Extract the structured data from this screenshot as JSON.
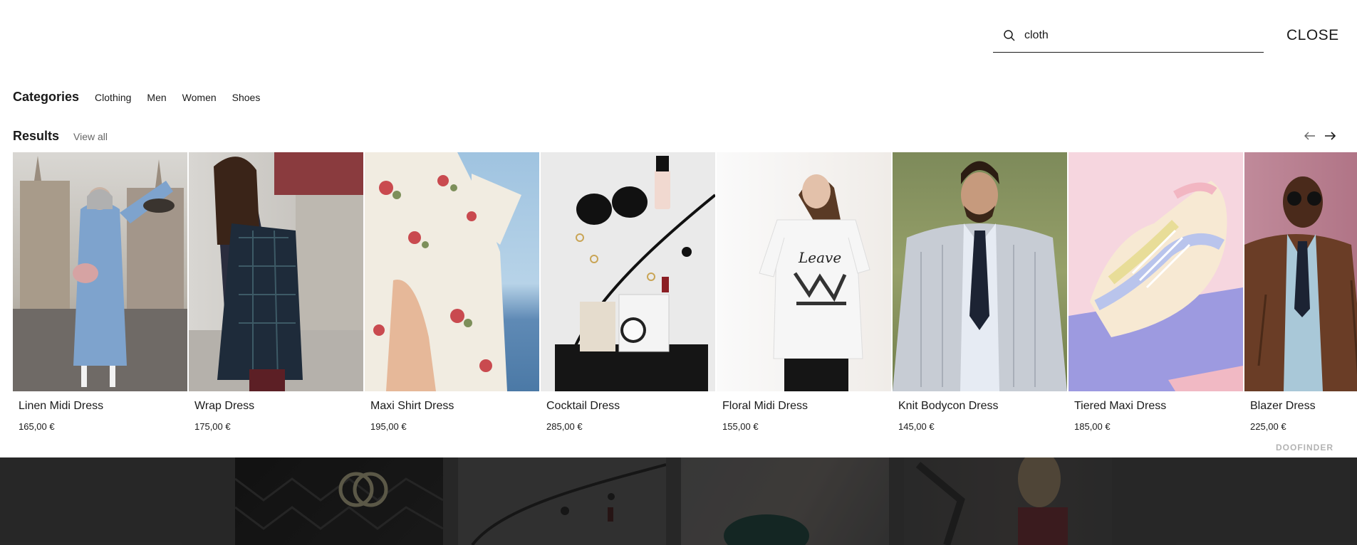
{
  "search": {
    "value": "cloth",
    "placeholder": "Search"
  },
  "close_label": "CLOSE",
  "categories": {
    "title": "Categories",
    "items": [
      "Clothing",
      "Men",
      "Women",
      "Shoes"
    ]
  },
  "results": {
    "title": "Results",
    "view_all": "View all",
    "items": [
      {
        "name": "Linen Midi Dress",
        "price": "165,00 €"
      },
      {
        "name": "Wrap Dress",
        "price": "175,00 €"
      },
      {
        "name": "Maxi Shirt Dress",
        "price": "195,00 €"
      },
      {
        "name": "Cocktail Dress",
        "price": "285,00 €"
      },
      {
        "name": "Floral Midi Dress",
        "price": "155,00 €"
      },
      {
        "name": "Knit Bodycon Dress",
        "price": "145,00 €"
      },
      {
        "name": "Tiered Maxi Dress",
        "price": "185,00 €"
      },
      {
        "name": "Blazer Dress",
        "price": "225,00 €"
      }
    ]
  },
  "brand": "DOOFINDER",
  "icons": {
    "search": "search-icon",
    "prev": "arrow-left-icon",
    "next": "arrow-right-icon"
  }
}
